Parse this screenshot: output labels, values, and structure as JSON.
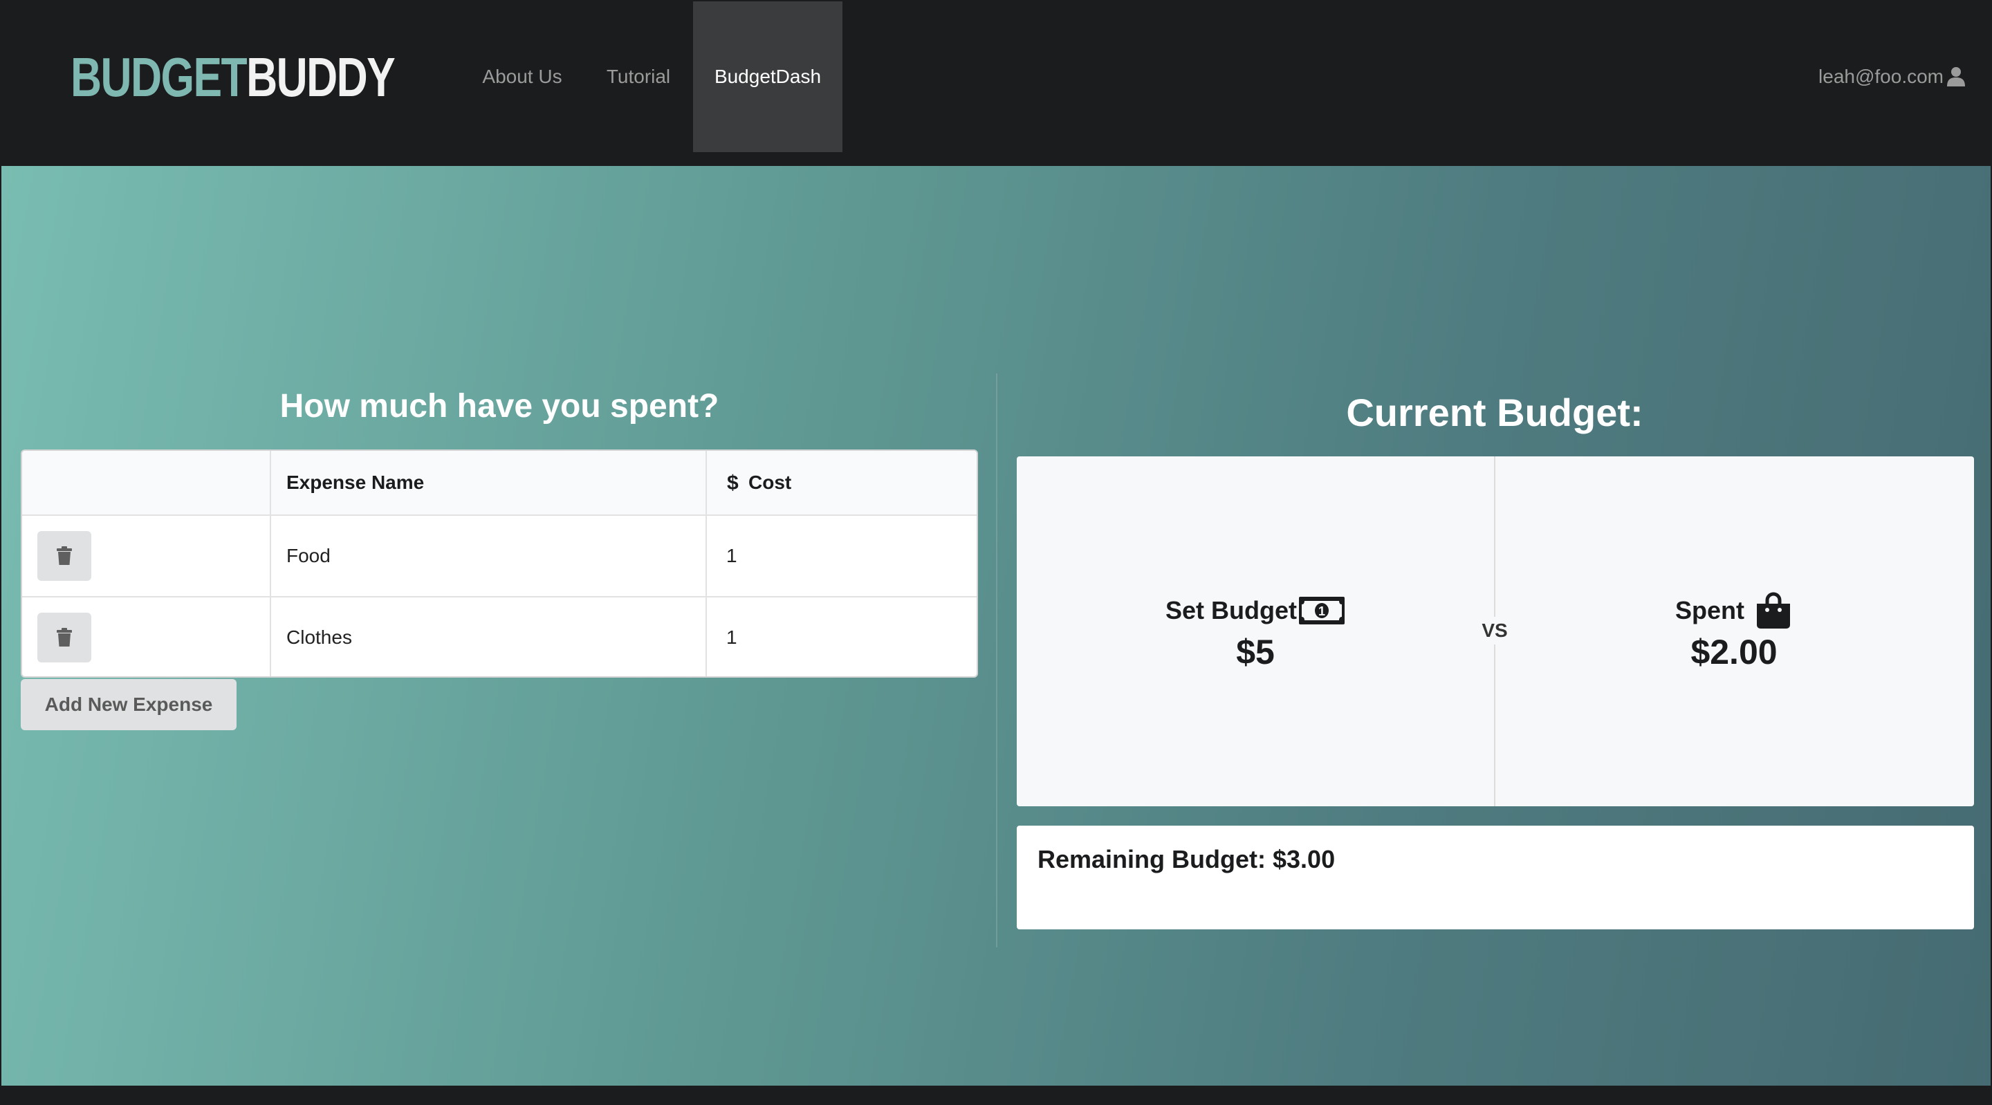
{
  "navbar": {
    "logo_part1": "BUDGET",
    "logo_part2": "BUDDY",
    "items": [
      {
        "label": "About Us"
      },
      {
        "label": "Tutorial"
      },
      {
        "label": "BudgetDash",
        "active": true
      }
    ],
    "user_email": "leah@foo.com",
    "user_icon": "user-icon"
  },
  "expenses": {
    "title": "How much have you spent?",
    "columns": [
      "",
      "Expense Name",
      "Cost"
    ],
    "cost_icon": "dollar-icon",
    "rows": [
      {
        "name": "Food",
        "cost": "1"
      },
      {
        "name": "Clothes",
        "cost": "1"
      }
    ],
    "delete_icon": "trash-icon",
    "add_label": "Add New Expense"
  },
  "budget": {
    "title": "Current Budget:",
    "set_label": "Set Budget",
    "set_icon": "money-bill-icon",
    "set_value": "$5",
    "vs_label": "VS",
    "spent_label": "Spent",
    "spent_icon": "shopping-bag-icon",
    "spent_value": "$2.00",
    "remaining": "Remaining Budget: $3.00"
  },
  "colors": {
    "navbar_bg": "#1b1c1d",
    "active_nav_bg": "#3b3c3e",
    "gradient_start": "#79bcb1",
    "gradient_end": "#466b72",
    "logo_accent": "#7fb8b1"
  }
}
